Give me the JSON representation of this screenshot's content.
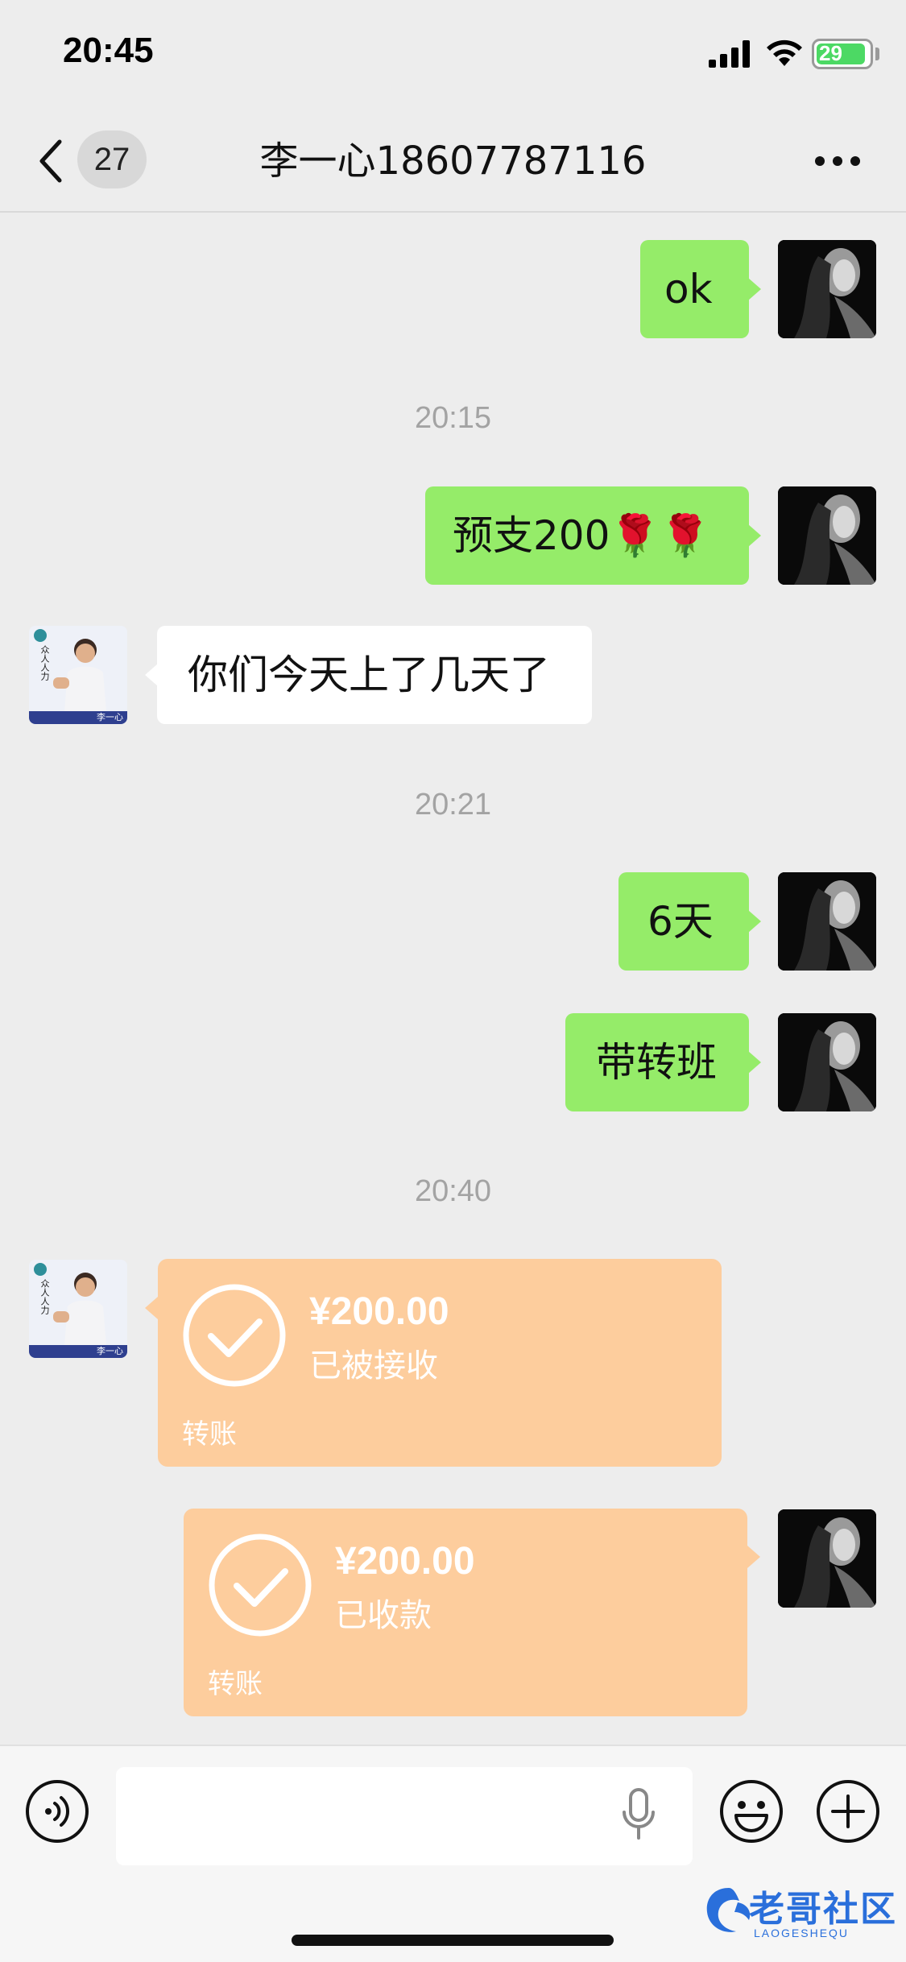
{
  "status_bar": {
    "time": "20:45",
    "battery": "29"
  },
  "nav": {
    "unread_count": "27",
    "title": "李一心18607787116"
  },
  "messages": [
    {
      "type": "text",
      "from": "me",
      "text": "ok"
    },
    {
      "type": "time",
      "text": "20:15"
    },
    {
      "type": "text",
      "from": "me",
      "text": "预支200🌹🌹"
    },
    {
      "type": "text",
      "from": "contact",
      "text": "你们今天上了几天了"
    },
    {
      "type": "time",
      "text": "20:21"
    },
    {
      "type": "text",
      "from": "me",
      "text": "6天"
    },
    {
      "type": "text",
      "from": "me",
      "text": "带转班"
    },
    {
      "type": "time",
      "text": "20:40"
    },
    {
      "type": "transfer",
      "from": "contact",
      "amount": "¥200.00",
      "status": "已被接收",
      "label": "转账"
    },
    {
      "type": "transfer",
      "from": "me",
      "amount": "¥200.00",
      "status": "已收款",
      "label": "转账"
    }
  ],
  "contact_avatar": {
    "logo_text": "众人人力",
    "name_tag": "李一心"
  },
  "input_bar": {
    "text_value": ""
  },
  "watermark": {
    "text": "老哥社区",
    "subtext": "LAOGESHEQU"
  },
  "colors": {
    "background": "#ededed",
    "my_bubble": "#95ec69",
    "their_bubble": "#ffffff",
    "transfer_card": "#fdcd9d",
    "timestamp": "#a3a3a3"
  }
}
